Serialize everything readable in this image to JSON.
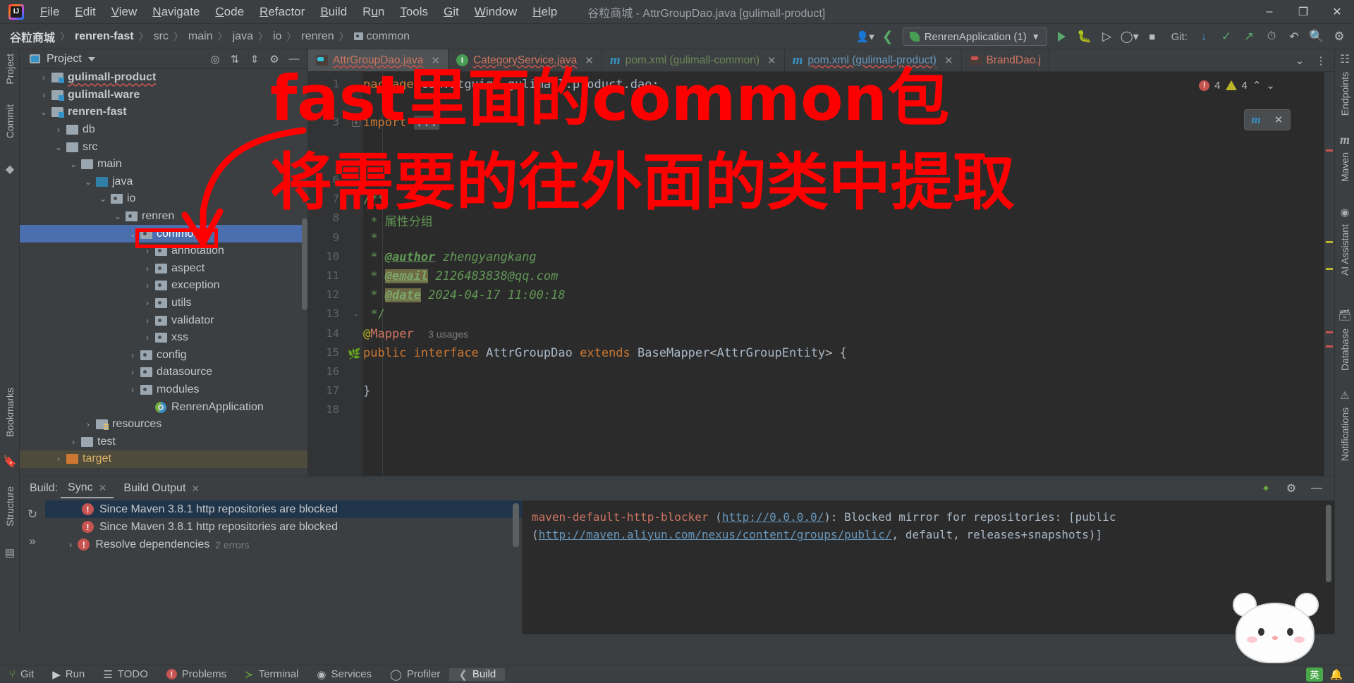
{
  "titlebar": {
    "menu": [
      "File",
      "Edit",
      "View",
      "Navigate",
      "Code",
      "Refactor",
      "Build",
      "Run",
      "Tools",
      "Git",
      "Window",
      "Help"
    ],
    "window_title": "谷粒商城 - AttrGroupDao.java [gulimall-product]",
    "minimize": "–",
    "maximize": "❐",
    "close": "✕"
  },
  "navbar": {
    "breadcrumbs": [
      "谷粒商城",
      "renren-fast",
      "src",
      "main",
      "java",
      "io",
      "renren",
      "common"
    ],
    "separator": "〉",
    "run_config": "RenrenApplication (1)",
    "git_label": "Git:",
    "icons": {
      "user": "user-icon",
      "hammer": "build-hammer-icon",
      "run": "run-icon",
      "debug": "debug-icon",
      "coverage": "run-with-coverage-icon",
      "profiler": "profiler-icon",
      "stop": "stop-icon",
      "update": "git-update-icon",
      "commit": "git-commit-icon",
      "push": "git-push-icon",
      "history": "history-icon",
      "rollback": "rollback-icon",
      "search": "search-everywhere-icon",
      "settings": "settings-icon"
    }
  },
  "left_strip": [
    {
      "label": "Project",
      "name": "tool-window-project"
    },
    {
      "label": "Commit",
      "name": "tool-window-commit"
    },
    {
      "label": "Bookmarks",
      "name": "tool-window-bookmarks"
    },
    {
      "label": "Structure",
      "name": "tool-window-structure"
    }
  ],
  "right_strip": [
    {
      "label": "Endpoints",
      "name": "tool-window-endpoints"
    },
    {
      "label": "Maven",
      "name": "tool-window-maven"
    },
    {
      "label": "AI Assistant",
      "name": "tool-window-ai-assistant"
    },
    {
      "label": "Database",
      "name": "tool-window-database"
    },
    {
      "label": "Notifications",
      "name": "tool-window-notifications"
    }
  ],
  "project_panel": {
    "title": "Project",
    "tree": [
      {
        "label": "gulimall-product",
        "indent": 1,
        "arrow": "›",
        "icon": "module-folder-icon",
        "bold": true,
        "squiggle": true
      },
      {
        "label": "gulimall-ware",
        "indent": 1,
        "arrow": "›",
        "icon": "module-folder-icon",
        "bold": true
      },
      {
        "label": "renren-fast",
        "indent": 1,
        "arrow": "⌄",
        "icon": "module-folder-icon",
        "bold": true
      },
      {
        "label": "db",
        "indent": 2,
        "arrow": "›",
        "icon": "folder-icon"
      },
      {
        "label": "src",
        "indent": 2,
        "arrow": "⌄",
        "icon": "folder-icon"
      },
      {
        "label": "main",
        "indent": 3,
        "arrow": "⌄",
        "icon": "folder-icon"
      },
      {
        "label": "java",
        "indent": 4,
        "arrow": "⌄",
        "icon": "source-root-icon"
      },
      {
        "label": "io",
        "indent": 5,
        "arrow": "⌄",
        "icon": "package-icon"
      },
      {
        "label": "renren",
        "indent": 6,
        "arrow": "⌄",
        "icon": "package-icon"
      },
      {
        "label": "common",
        "indent": 7,
        "arrow": "⌄",
        "icon": "package-icon",
        "selected": true
      },
      {
        "label": "annotation",
        "indent": 8,
        "arrow": "›",
        "icon": "package-icon"
      },
      {
        "label": "aspect",
        "indent": 8,
        "arrow": "›",
        "icon": "package-icon"
      },
      {
        "label": "exception",
        "indent": 8,
        "arrow": "›",
        "icon": "package-icon"
      },
      {
        "label": "utils",
        "indent": 8,
        "arrow": "›",
        "icon": "package-icon"
      },
      {
        "label": "validator",
        "indent": 8,
        "arrow": "›",
        "icon": "package-icon"
      },
      {
        "label": "xss",
        "indent": 8,
        "arrow": "›",
        "icon": "package-icon"
      },
      {
        "label": "config",
        "indent": 7,
        "arrow": "›",
        "icon": "package-icon"
      },
      {
        "label": "datasource",
        "indent": 7,
        "arrow": "›",
        "icon": "package-icon"
      },
      {
        "label": "modules",
        "indent": 7,
        "arrow": "›",
        "icon": "package-icon"
      },
      {
        "label": "RenrenApplication",
        "indent": 8,
        "arrow": "",
        "icon": "spring-class-icon"
      },
      {
        "label": "resources",
        "indent": 4,
        "arrow": "›",
        "icon": "resource-folder-icon"
      },
      {
        "label": "test",
        "indent": 3,
        "arrow": "›",
        "icon": "folder-icon"
      },
      {
        "label": "target",
        "indent": 2,
        "arrow": "›",
        "icon": "target-folder-icon",
        "highlight": true
      }
    ]
  },
  "editor": {
    "tabs": [
      {
        "label": "AttrGroupDao.java",
        "icon": "dao-class-icon",
        "active": true,
        "color": "red",
        "error": true
      },
      {
        "label": "CategoryService.java",
        "icon": "interface-icon",
        "active": false,
        "color": "red",
        "error": true
      },
      {
        "label": "pom.xml (gulimall-common)",
        "icon": "maven-icon",
        "active": false,
        "color": "blue"
      },
      {
        "label": "pom.xml (gulimall-product)",
        "icon": "maven-icon",
        "active": false,
        "color": "blue",
        "error": true
      },
      {
        "label": "BrandDao.j",
        "icon": "dao-class-icon",
        "active": false,
        "color": "red"
      }
    ],
    "tab_overflow": "⌄",
    "tab_menu": "⋮",
    "inspection": {
      "errors": "4",
      "warnings": "4",
      "up": "⌃",
      "down": "⌄"
    },
    "code_lines": [
      {
        "num": "1",
        "fold": "",
        "html": "<span class='c-kw'>package</span> <span class='c-type'>com.atguigu.gulimall.product.dao</span>;"
      },
      {
        "num": "3",
        "fold": "+",
        "html": "<span class='c-import'>import</span> <span class='c-dots'>...</span>"
      },
      {
        "num": "6",
        "fold": "",
        "html": ""
      },
      {
        "num": "7",
        "fold": "-",
        "html": "<span class='c-comment'>/**</span>"
      },
      {
        "num": "8",
        "fold": "",
        "html": "<span class='c-comment'> * 属性分组</span>"
      },
      {
        "num": "9",
        "fold": "",
        "html": "<span class='c-comment'> *</span>"
      },
      {
        "num": "10",
        "fold": "",
        "html": "<span class='c-comment'> * </span><span class='c-tag'>@author</span><span class='c-val'> zhengyangkang</span>"
      },
      {
        "num": "11",
        "fold": "",
        "html": "<span class='c-comment'> * </span><span class='c-tag-hl'>@email</span><span class='c-val'> 2126483838@qq.com</span>"
      },
      {
        "num": "12",
        "fold": "",
        "html": "<span class='c-comment'> * </span><span class='c-tag-hl'>@date</span><span class='c-val'> 2024-04-17 11:00:18</span>"
      },
      {
        "num": "13",
        "fold": "-",
        "html": "<span class='c-comment'> */</span>"
      },
      {
        "num": "14",
        "fold": "",
        "html": "<span class='c-anno'>@</span><span class='c-anno2'>Mapper</span>  <span class='c-usage'>3 usages</span>"
      },
      {
        "num": "15",
        "fold": "",
        "html": "<span class='c-kw'>public</span> <span class='c-kw'>interface</span> <span class='c-type'>AttrGroupDao</span> <span class='c-kw'>extends</span> <span class='c-type'>BaseMapper</span>&lt;<span class='c-type'>AttrGroupEntity</span>&gt; {"
      },
      {
        "num": "16",
        "fold": "",
        "html": ""
      },
      {
        "num": "17",
        "fold": "",
        "html": "<span class='c-type'>}</span>"
      },
      {
        "num": "18",
        "fold": "",
        "html": ""
      }
    ]
  },
  "build_panel": {
    "title": "Build:",
    "tabs": [
      {
        "label": "Sync",
        "active": true,
        "closable": true
      },
      {
        "label": "Build Output",
        "active": false,
        "closable": true
      }
    ],
    "tree_rows": [
      {
        "label": "Since Maven 3.8.1 http repositories are blocked",
        "selected": true,
        "icon": "error-icon"
      },
      {
        "label": "Since Maven 3.8.1 http repositories are blocked",
        "selected": false,
        "icon": "error-icon"
      },
      {
        "label": "Resolve dependencies",
        "suffix": "2 errors",
        "selected": false,
        "icon": "error-icon",
        "arrow": "›"
      }
    ],
    "console": [
      "maven-default-http-blocker (http://0.0.0.0/): Blocked mirror for repositories: [public",
      "(http://maven.aliyun.com/nexus/content/groups/public/, default, releases+snapshots)]"
    ],
    "console_links": [
      "http://0.0.0.0/",
      "http://maven.aliyun.com/nexus/content/groups/public/"
    ],
    "refresh_icon": "refresh-icon",
    "expand_icon": "»"
  },
  "statusbar": {
    "items": [
      {
        "label": "Git",
        "icon": "git-branch-icon",
        "active": false
      },
      {
        "label": "Run",
        "icon": "run-icon",
        "active": false
      },
      {
        "label": "TODO",
        "icon": "todo-icon",
        "active": false
      },
      {
        "label": "Problems",
        "icon": "problems-icon",
        "active": false
      },
      {
        "label": "Terminal",
        "icon": "terminal-icon",
        "active": false
      },
      {
        "label": "Services",
        "icon": "services-icon",
        "active": false
      },
      {
        "label": "Profiler",
        "icon": "profiler-icon",
        "active": false
      },
      {
        "label": "Build",
        "icon": "build-icon",
        "active": true
      }
    ],
    "right_icons": [
      "ime-icon",
      "notification-icon"
    ]
  },
  "annotations": {
    "line1": "fast里面的common包",
    "line2": "将需要的往外面的类中提取",
    "color": "#ff0000"
  },
  "colors": {
    "accent": "#4b6eaf",
    "error": "#c75450",
    "warning": "#bbb529",
    "annotation_red": "#ff0000",
    "editor_bg": "#2b2b2b",
    "panel_bg": "#3c3f41"
  }
}
